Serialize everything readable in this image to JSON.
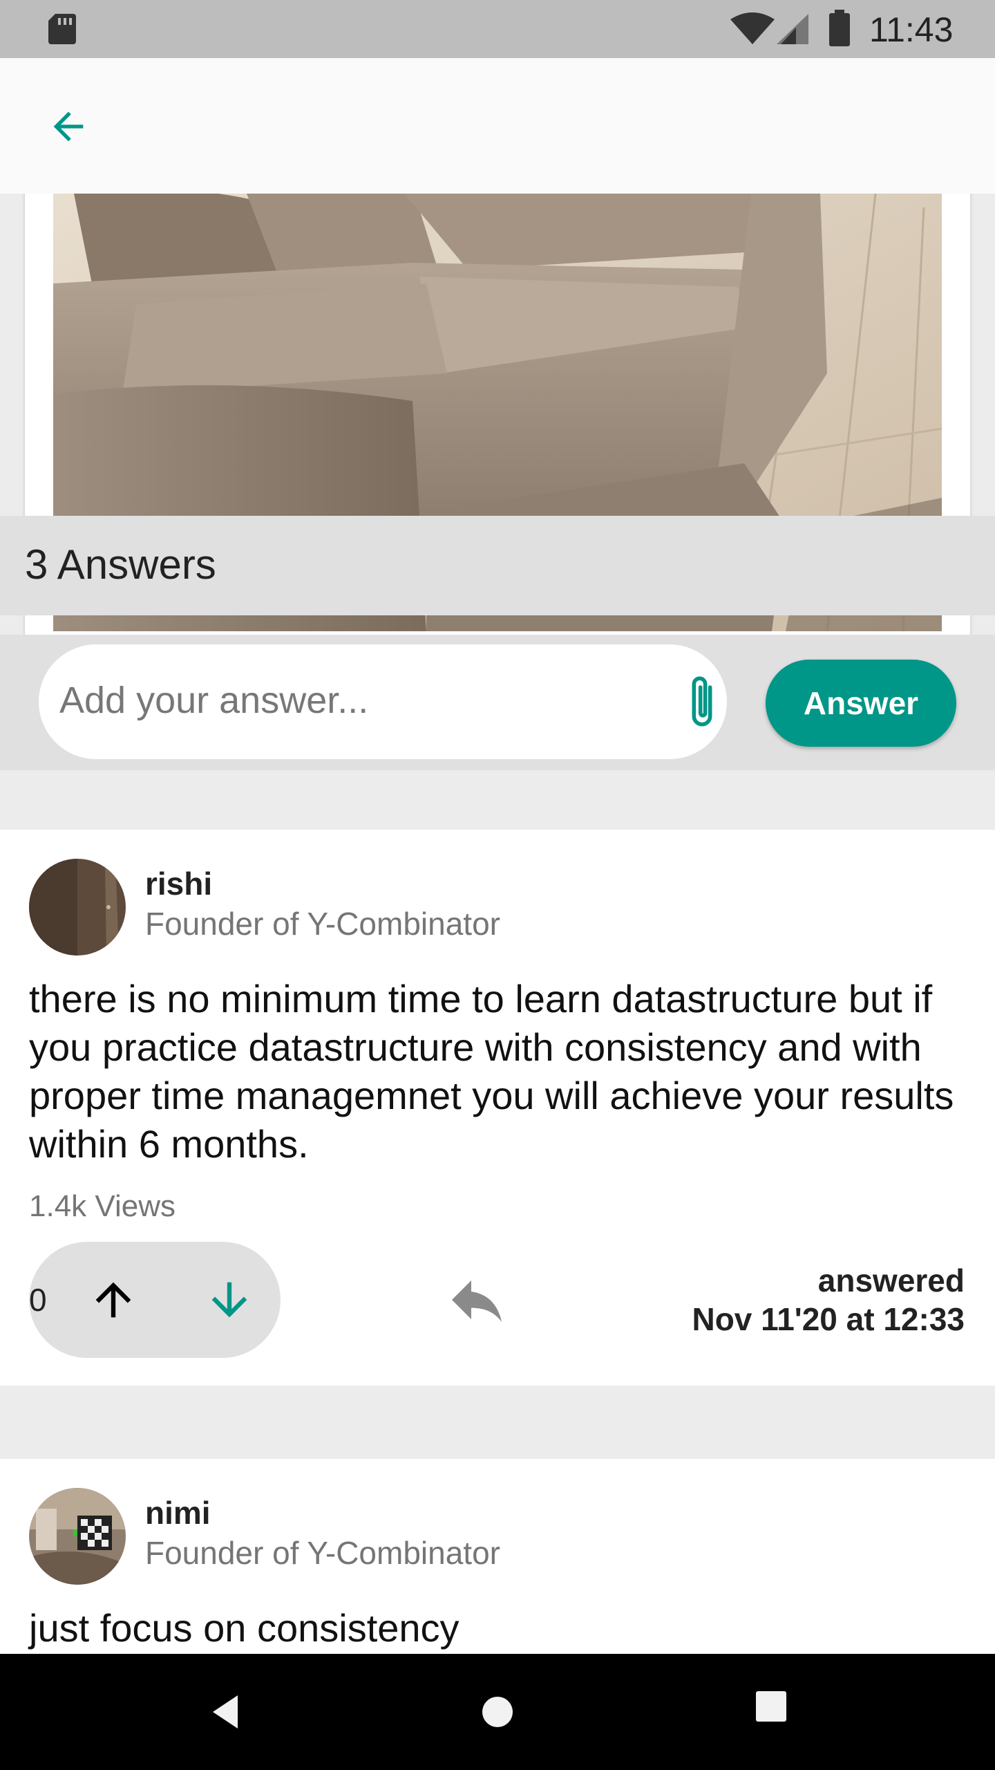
{
  "status_bar": {
    "time": "11:43",
    "icons": [
      "sd-card-icon",
      "wifi-icon",
      "signal-icon",
      "battery-icon"
    ]
  },
  "app_bar": {
    "back_icon": "arrow-left-icon"
  },
  "question": {
    "image": "sofa-photo"
  },
  "answers_section": {
    "title": "3 Answers"
  },
  "compose": {
    "placeholder": "Add your answer...",
    "attach_icon": "paperclip-icon",
    "submit_label": "Answer"
  },
  "answers": [
    {
      "name": "rishi",
      "role": "Founder of Y-Combinator",
      "body": "there is no minimum time to learn datastructure but if you practice datastructure with consistency and with proper time managemnet you will achieve your results within 6 months.",
      "views": "1.4k Views",
      "votes": "0",
      "answered_label": "answered",
      "answered_date": "Nov 11'20 at 12:33"
    },
    {
      "name": "nimi",
      "role": "Founder of Y-Combinator",
      "body": "just focus on consistency"
    }
  ],
  "colors": {
    "accent": "#009688",
    "status_bar": "#bdbdbd",
    "section_bg": "#e0e0e0",
    "page_bg": "#ececec"
  }
}
